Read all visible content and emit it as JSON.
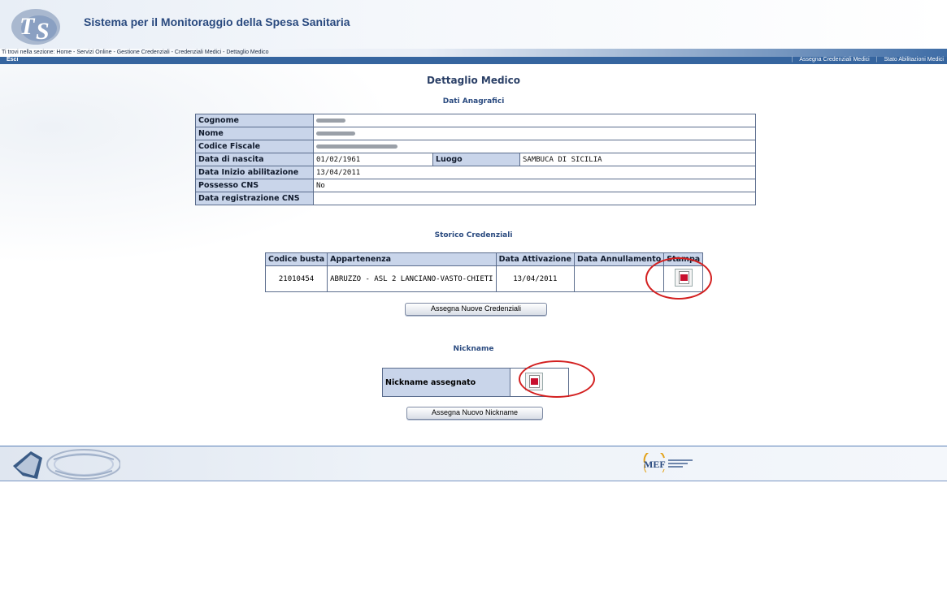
{
  "header": {
    "app_title": "Sistema per il Monitoraggio della Spesa Sanitaria",
    "breadcrumb": "Ti trovi nella sezione: Home - Servizi Online - Gestione Credenziali - Credenziali Medici - Dettaglio Medico",
    "exit_label": "Esci",
    "nav_links": [
      "Assegna Credenziali Medici",
      "Stato Abilitazioni Medici"
    ]
  },
  "main": {
    "page_title": "Dettaglio Medico",
    "anagrafici_title": "Dati Anagrafici",
    "anagrafici": {
      "cognome_label": "Cognome",
      "nome_label": "Nome",
      "codice_fiscale_label": "Codice Fiscale",
      "data_nascita_label": "Data di nascita",
      "data_nascita_value": "01/02/1961",
      "luogo_label": "Luogo",
      "luogo_value": "SAMBUCA DI SICILIA",
      "data_inizio_label": "Data Inizio abilitazione",
      "data_inizio_value": "13/04/2011",
      "possesso_cns_label": "Possesso CNS",
      "possesso_cns_value": "No",
      "data_registrazione_label": "Data registrazione CNS",
      "data_registrazione_value": ""
    },
    "storico_title": "Storico Credenziali",
    "storico": {
      "headers": [
        "Codice busta",
        "Appartenenza",
        "Data Attivazione",
        "Data Annullamento",
        "Stampa"
      ],
      "rows": [
        {
          "codice_busta": "21010454",
          "appartenenza": "ABRUZZO - ASL 2 LANCIANO-VASTO-CHIETI",
          "data_attivazione": "13/04/2011",
          "data_annullamento": ""
        }
      ]
    },
    "assegna_credenziali_label": "Assegna Nuove Credenziali",
    "nickname_title": "Nickname",
    "nickname_label": "Nickname assegnato",
    "assegna_nickname_label": "Assegna Nuovo Nickname"
  },
  "footer": {
    "mef_logo_text": "MEF"
  },
  "colors": {
    "nav_blue": "#36659f",
    "label_bg": "#c9d5ea",
    "annotation_red": "#d32020"
  },
  "icons": [
    "ts-logo",
    "pdf-icon",
    "emblem",
    "mef-logo"
  ]
}
